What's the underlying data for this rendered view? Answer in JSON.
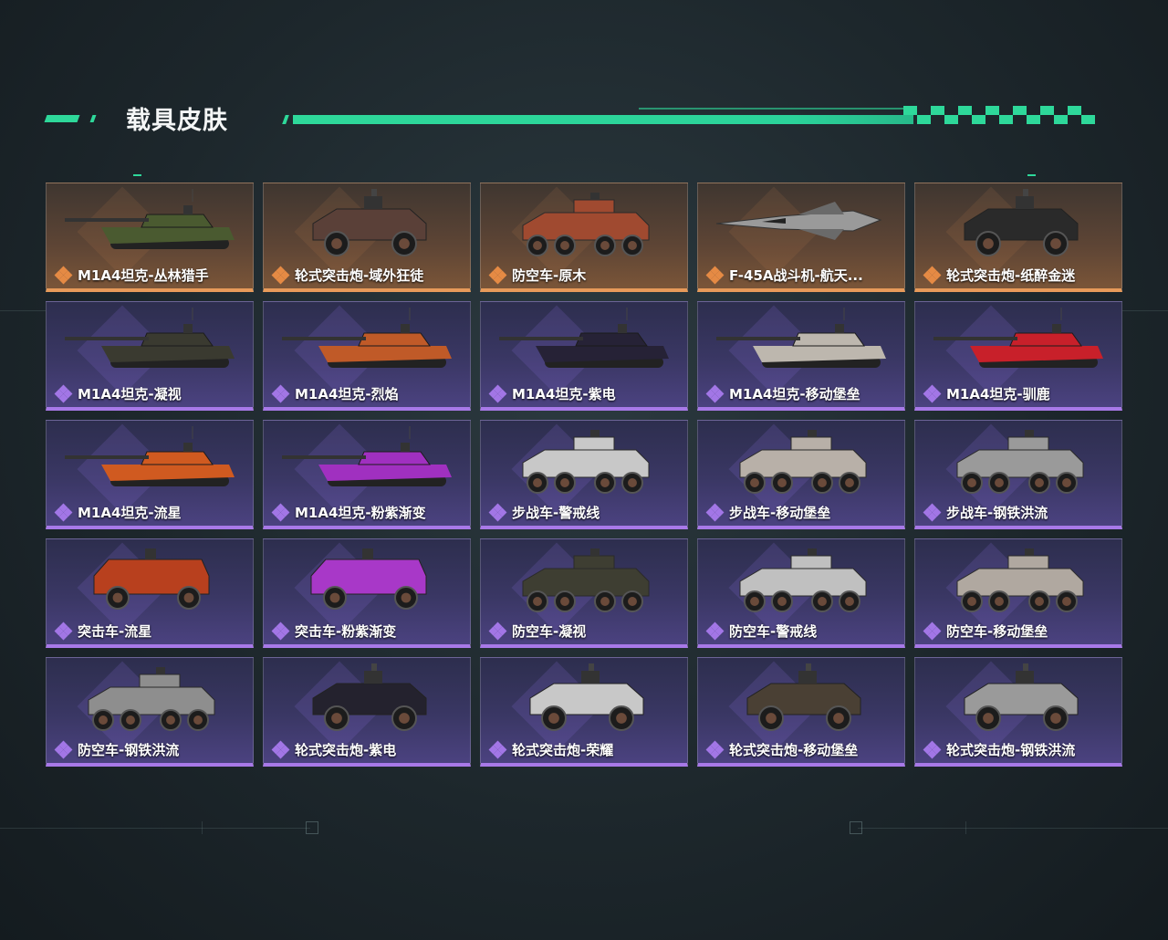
{
  "header": {
    "title": "载具皮肤"
  },
  "colors": {
    "accent": "#2ed89a",
    "gold": "#e79a5a",
    "purple": "#a879e8"
  },
  "skins": [
    {
      "label": "M1A4坦克-丛林猎手",
      "rarity": "gold",
      "vehicle": "tank",
      "paint": "#4a5a30"
    },
    {
      "label": "轮式突击炮-域外狂徒",
      "rarity": "gold",
      "vehicle": "buggy",
      "paint": "#5a4038"
    },
    {
      "label": "防空车-原木",
      "rarity": "gold",
      "vehicle": "apc",
      "paint": "#a04a30"
    },
    {
      "label": "F-45A战斗机-航天...",
      "rarity": "gold",
      "vehicle": "jet",
      "paint": "#9a9a9a"
    },
    {
      "label": "轮式突击炮-纸醉金迷",
      "rarity": "gold",
      "vehicle": "buggy",
      "paint": "#2a2a2a"
    },
    {
      "label": "M1A4坦克-凝视",
      "rarity": "purple",
      "vehicle": "tank",
      "paint": "#3a3a30"
    },
    {
      "label": "M1A4坦克-烈焰",
      "rarity": "purple",
      "vehicle": "tank",
      "paint": "#c05a28"
    },
    {
      "label": "M1A4坦克-紫电",
      "rarity": "purple",
      "vehicle": "tank",
      "paint": "#262236"
    },
    {
      "label": "M1A4坦克-移动堡垒",
      "rarity": "purple",
      "vehicle": "tank",
      "paint": "#bdb7ae"
    },
    {
      "label": "M1A4坦克-驯鹿",
      "rarity": "purple",
      "vehicle": "tank",
      "paint": "#c8202a"
    },
    {
      "label": "M1A4坦克-流星",
      "rarity": "purple",
      "vehicle": "tank",
      "paint": "#d05a20"
    },
    {
      "label": "M1A4坦克-粉紫渐变",
      "rarity": "purple",
      "vehicle": "tank",
      "paint": "#a030c0"
    },
    {
      "label": "步战车-警戒线",
      "rarity": "purple",
      "vehicle": "apc",
      "paint": "#c8c8c8"
    },
    {
      "label": "步战车-移动堡垒",
      "rarity": "purple",
      "vehicle": "apc",
      "paint": "#b8b0a8"
    },
    {
      "label": "步战车-钢铁洪流",
      "rarity": "purple",
      "vehicle": "apc",
      "paint": "#9a9a9a"
    },
    {
      "label": "突击车-流星",
      "rarity": "purple",
      "vehicle": "truck",
      "paint": "#b8401e"
    },
    {
      "label": "突击车-粉紫渐变",
      "rarity": "purple",
      "vehicle": "truck",
      "paint": "#a838c8"
    },
    {
      "label": "防空车-凝视",
      "rarity": "purple",
      "vehicle": "apc",
      "paint": "#3e3e32"
    },
    {
      "label": "防空车-警戒线",
      "rarity": "purple",
      "vehicle": "apc",
      "paint": "#c0c0c0"
    },
    {
      "label": "防空车-移动堡垒",
      "rarity": "purple",
      "vehicle": "apc",
      "paint": "#b0a8a0"
    },
    {
      "label": "防空车-钢铁洪流",
      "rarity": "purple",
      "vehicle": "apc",
      "paint": "#8e8e8e"
    },
    {
      "label": "轮式突击炮-紫电",
      "rarity": "purple",
      "vehicle": "buggy",
      "paint": "#24222e"
    },
    {
      "label": "轮式突击炮-荣耀",
      "rarity": "purple",
      "vehicle": "buggy",
      "paint": "#c8c8c8"
    },
    {
      "label": "轮式突击炮-移动堡垒",
      "rarity": "purple",
      "vehicle": "buggy",
      "paint": "#4a4034"
    },
    {
      "label": "轮式突击炮-钢铁洪流",
      "rarity": "purple",
      "vehicle": "buggy",
      "paint": "#9a9a9a"
    }
  ]
}
